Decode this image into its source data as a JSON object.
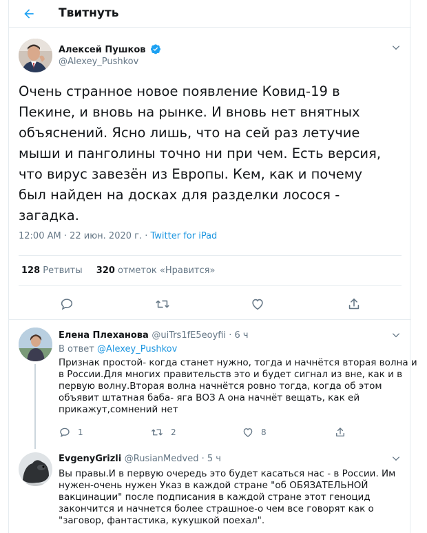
{
  "header": {
    "title": "Твитнуть",
    "back_icon": "arrow-left-icon"
  },
  "main_tweet": {
    "author_name": "Алексей Пушков",
    "author_handle": "@Alexey_Pushkov",
    "verified": true,
    "text_lines": [
      "Очень странное новое появление Ковид-19 в",
      "Пекине, и вновь на рынке. И вновь нет внятных",
      "объяснений. Ясно лишь, что на сей раз летучие",
      "мыши и панголины точно ни при чем. Есть версия,",
      "что вирус завезён из Европы. Кем, как и почему",
      "был найден на досках для разделки лосося -",
      "загадка."
    ],
    "timestamp": "12:00 AM · 22 июн. 2020 г. · ",
    "source": "Twitter for iPad",
    "retweets_count": "128",
    "retweets_label": " Ретвиты",
    "likes_count": "320",
    "likes_label": " отметок «Нравится»"
  },
  "replies": [
    {
      "author_name": "Елена Плеханова",
      "author_handle": "@uiTrs1fE5eoyfii",
      "time": " · 6 ч",
      "in_reply_prefix": "В ответ ",
      "in_reply_handle": "@Alexey_Pushkov",
      "text_lines": [
        "Признак простой- когда станет нужно, тогда и начнётся вторая волна и",
        "в России.Для многих правительств это и будет сигнал из вне, как и в",
        "первую волну.Вторая волна начнётся ровно тогда, когда об этом",
        "объявит штатная баба- яга ВОЗ А она начнёт вещать, как ей",
        "прикажут,сомнений нет"
      ],
      "reply_count": "1",
      "retweet_count": "2",
      "like_count": "8"
    },
    {
      "author_name": "EvgenyGrizli",
      "author_handle": "@RusianMedved",
      "time": " · 5 ч",
      "text_lines": [
        "Вы правы.И в первую очередь это будет касаться нас - в России. Им",
        "нужен-очень нужен Указ в каждой стране \"об ОБЯЗАТЕЛЬНОЙ",
        "вакцинации\" после подписания в каждой стране этот геноцид",
        "закончится и начнется более страшное-о чем все говорят как о",
        "\"заговор, фантастика, кукушкой поехал\"."
      ]
    }
  ],
  "colors": {
    "accent": "#1da1f2",
    "link": "#1b95e0",
    "muted": "#657786",
    "text": "#14171a",
    "border": "#e6ecf0"
  }
}
